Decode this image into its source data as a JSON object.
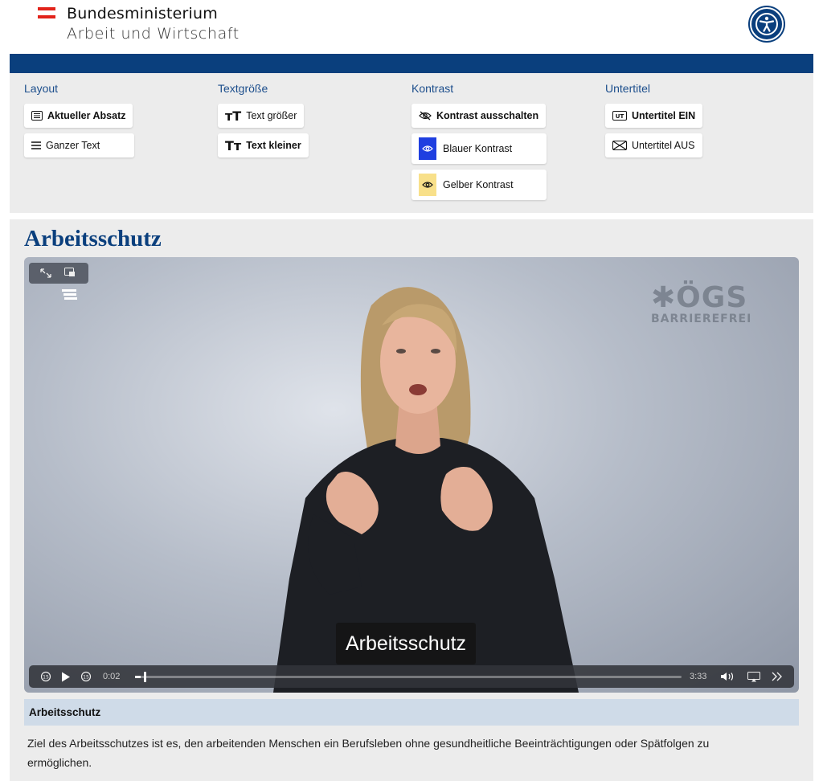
{
  "header": {
    "org_line1": "Bundesministerium",
    "org_line2": "Arbeit und Wirtschaft",
    "accessibility_icon": "accessibility-icon",
    "brand_color": "#0a3f7d",
    "flag_color": "#e2231a"
  },
  "settings": {
    "layout": {
      "title": "Layout",
      "buttons": [
        {
          "label": "Aktueller Absatz",
          "icon": "paragraph-icon",
          "selected": true
        },
        {
          "label": "Ganzer Text",
          "icon": "list-icon",
          "selected": false
        }
      ]
    },
    "textsize": {
      "title": "Textgröße",
      "buttons": [
        {
          "label": "Text größer",
          "icon": "text-larger-icon",
          "selected": false
        },
        {
          "label": "Text kleiner",
          "icon": "text-smaller-icon",
          "selected": true
        }
      ]
    },
    "contrast": {
      "title": "Kontrast",
      "buttons": [
        {
          "label": "Kontrast ausschalten",
          "icon": "eye-off-icon",
          "selected": true
        },
        {
          "label": "Blauer Kontrast",
          "icon": "eye-icon",
          "swatch": "#1f3fe0"
        },
        {
          "label": "Gelber Kontrast",
          "icon": "eye-icon",
          "swatch": "#f8e08a"
        }
      ]
    },
    "subtitles": {
      "title": "Untertitel",
      "buttons": [
        {
          "label": "Untertitel EIN",
          "icon": "subtitles-on-icon",
          "selected": true
        },
        {
          "label": "Untertitel AUS",
          "icon": "subtitles-off-icon",
          "selected": false
        }
      ]
    }
  },
  "main": {
    "title": "Arbeitsschutz",
    "video": {
      "watermark_big": "✱ÖGS",
      "watermark_small": "BARRIEREFREI",
      "caption": "Arbeitsschutz",
      "current_time": "0:02",
      "duration": "3:33",
      "progress_fraction": 0.01
    },
    "transcript_heading": "Arbeitsschutz",
    "transcript_text": "Ziel des Arbeitsschutzes ist es, den arbeitenden Menschen ein Berufsleben ohne gesundheitliche Beeinträchtigungen oder Spätfolgen zu ermöglichen."
  }
}
